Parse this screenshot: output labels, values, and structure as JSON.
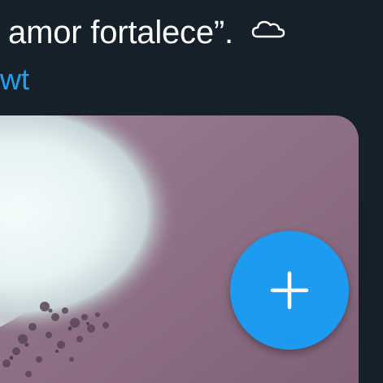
{
  "tweet": {
    "text_line": "- amor fortalece”.",
    "hashtag_fragment": "wt"
  },
  "icons": {
    "cloud": "cloud-icon",
    "compose": "plus-icon"
  },
  "colors": {
    "background": "#15202b",
    "link": "#1da1f2",
    "fab": "#1d9bf0",
    "text": "#ffffff"
  }
}
